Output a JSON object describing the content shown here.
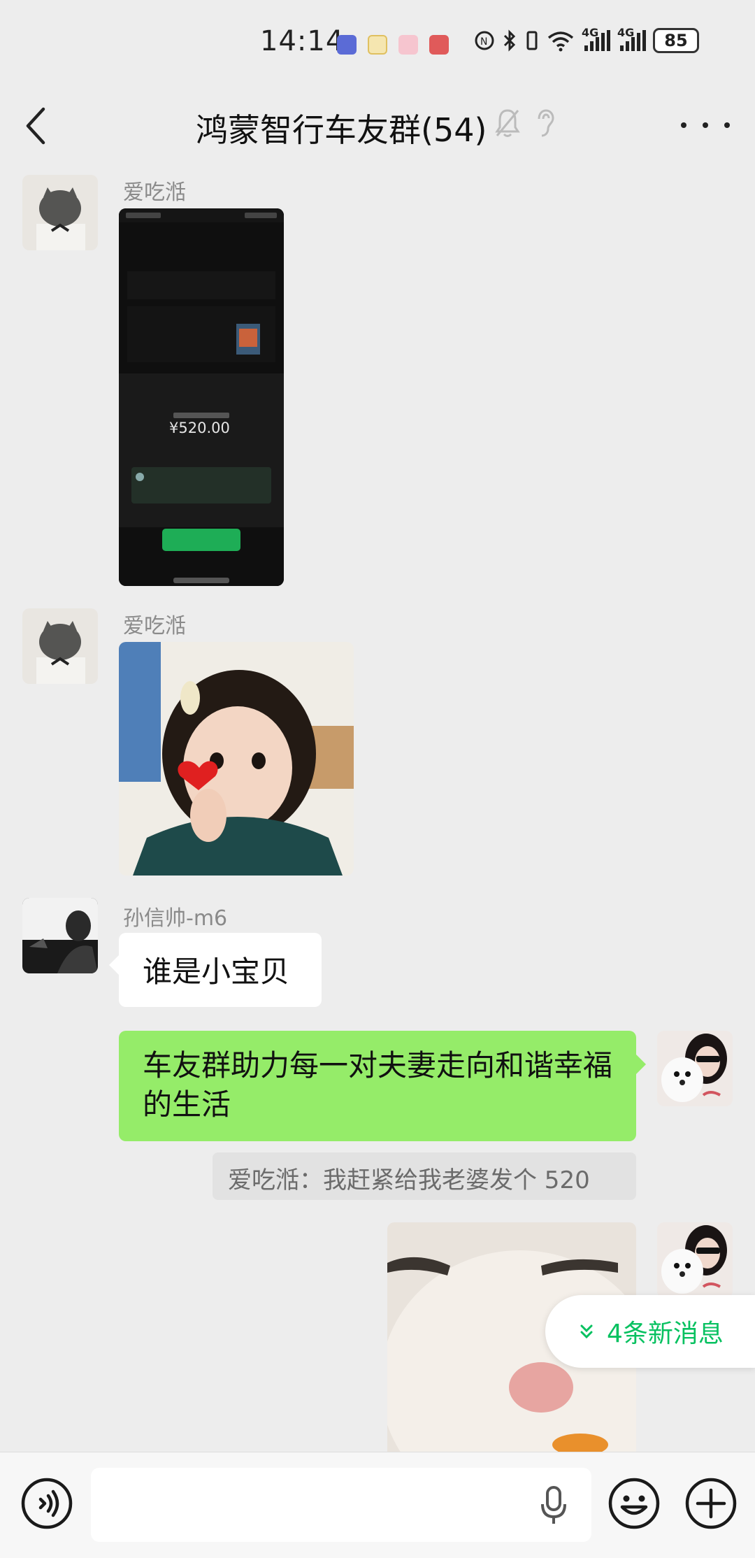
{
  "status_bar": {
    "time": "14:14",
    "network_1": "4G",
    "network_2": "4G",
    "battery": "85"
  },
  "header": {
    "title": "鸿蒙智行车友群(54)"
  },
  "messages": [
    {
      "type": "image",
      "sender": "爱吃湉",
      "image_caption": "¥520.00"
    },
    {
      "type": "image",
      "sender": "爱吃湉"
    },
    {
      "type": "text",
      "sender": "孙信帅-m6",
      "text": "谁是小宝贝"
    },
    {
      "type": "text_self",
      "text": "车友群助力每一对夫妻走向和谐幸福的生活",
      "quote": "爱吃湉：我赶紧给我老婆发个 520"
    },
    {
      "type": "image_self"
    }
  ],
  "new_messages_label": "4条新消息",
  "input": {
    "value": ""
  },
  "colors": {
    "accent": "#07c160",
    "bubble_self": "#95ec69",
    "background": "#ededed"
  }
}
